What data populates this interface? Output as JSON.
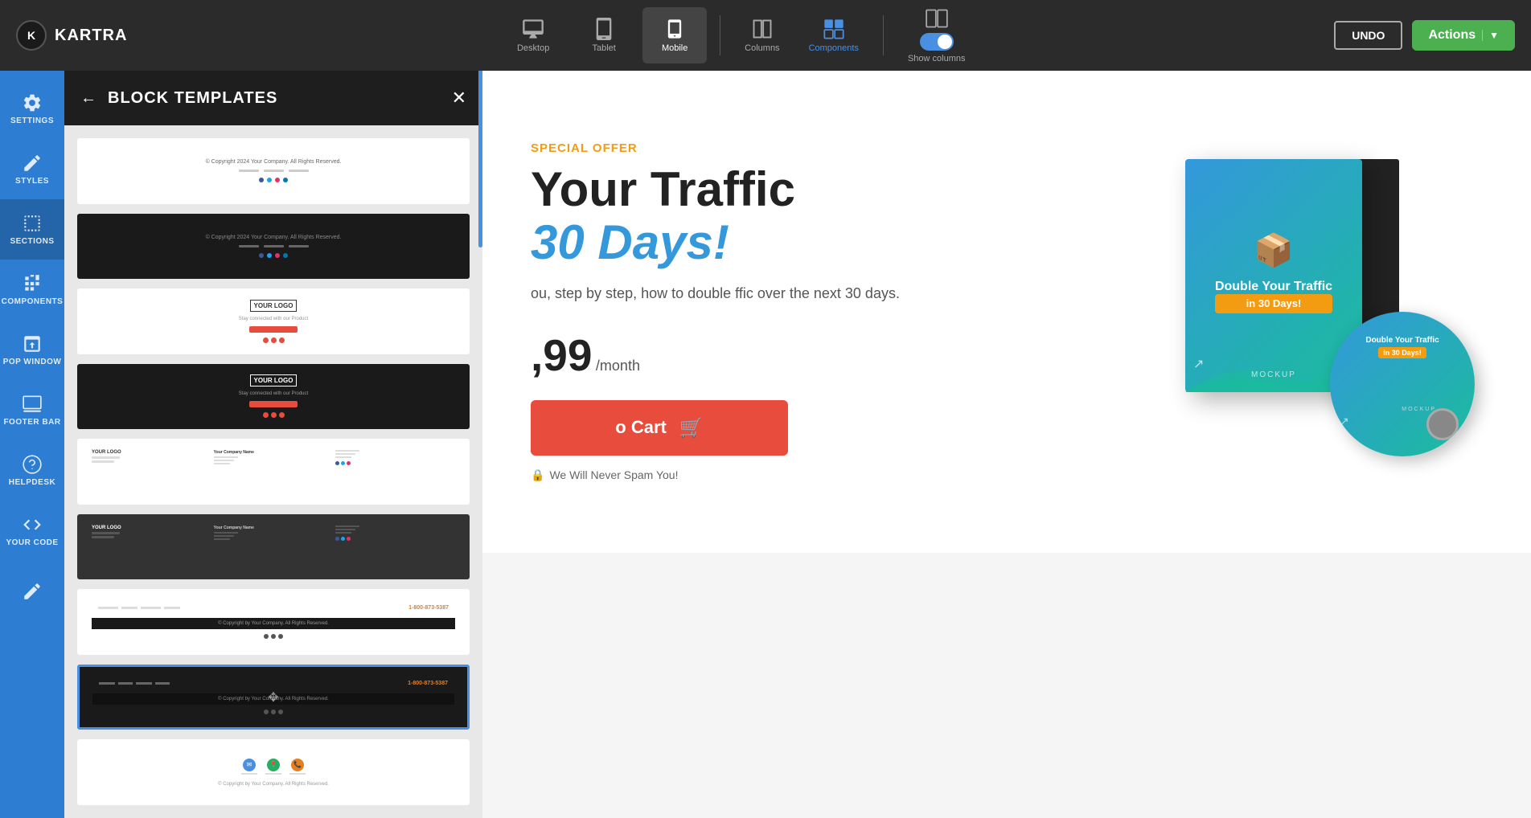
{
  "topbar": {
    "logo_text": "KARTRA",
    "logo_k": "K",
    "devices": [
      {
        "id": "desktop",
        "label": "Desktop",
        "active": false
      },
      {
        "id": "tablet",
        "label": "Tablet",
        "active": false
      },
      {
        "id": "mobile",
        "label": "Mobile",
        "active": true
      }
    ],
    "columns_label": "Columns",
    "components_label": "Components",
    "show_columns_label": "Show columns",
    "toggle_on": true,
    "undo_label": "UNDO",
    "actions_label": "Actions",
    "actions_chevron": "▼"
  },
  "sidebar": {
    "items": [
      {
        "id": "settings",
        "label": "SETTINGS"
      },
      {
        "id": "styles",
        "label": "STYLES"
      },
      {
        "id": "sections",
        "label": "SECTIONS",
        "active": true
      },
      {
        "id": "components",
        "label": "COMPONENTS"
      },
      {
        "id": "pop_window",
        "label": "POP WINDOW"
      },
      {
        "id": "footer_bar",
        "label": "FOOTER BAR"
      },
      {
        "id": "helpdesk",
        "label": "HELPDESK"
      },
      {
        "id": "your_code",
        "label": "YOUR CODE"
      },
      {
        "id": "pen",
        "label": ""
      }
    ]
  },
  "panel": {
    "title": "BLOCK TEMPLATES",
    "back_label": "←",
    "close_label": "✕",
    "templates": [
      {
        "id": 1,
        "style": "light"
      },
      {
        "id": 2,
        "style": "dark"
      },
      {
        "id": 3,
        "style": "light-logo"
      },
      {
        "id": 4,
        "style": "dark-logo"
      },
      {
        "id": 5,
        "style": "light-footer"
      },
      {
        "id": 6,
        "style": "dark-footer"
      },
      {
        "id": 7,
        "style": "light-phone"
      },
      {
        "id": 8,
        "style": "dark-selected"
      },
      {
        "id": 9,
        "style": "light-icons"
      }
    ]
  },
  "canvas": {
    "special_offer_label": "SPECIAL OFFER",
    "title_line1": "Your Traffic",
    "title_line2_italic": "30 Days!",
    "description": "ou, step by step, how to double\nffic over the next 30 days.",
    "price": ",99",
    "price_period": "/month",
    "add_to_cart_label": "o Cart",
    "spam_notice": "We Will Never Spam You!",
    "book_title": "Double Your Traffic",
    "book_subtitle": "in 30 Days!",
    "dvd_title": "Double Your Traffic",
    "dvd_subtitle": "in 30 Days!",
    "mockup_label": "MOCKUP",
    "dvd_mockup_label": "MOCKUP"
  }
}
